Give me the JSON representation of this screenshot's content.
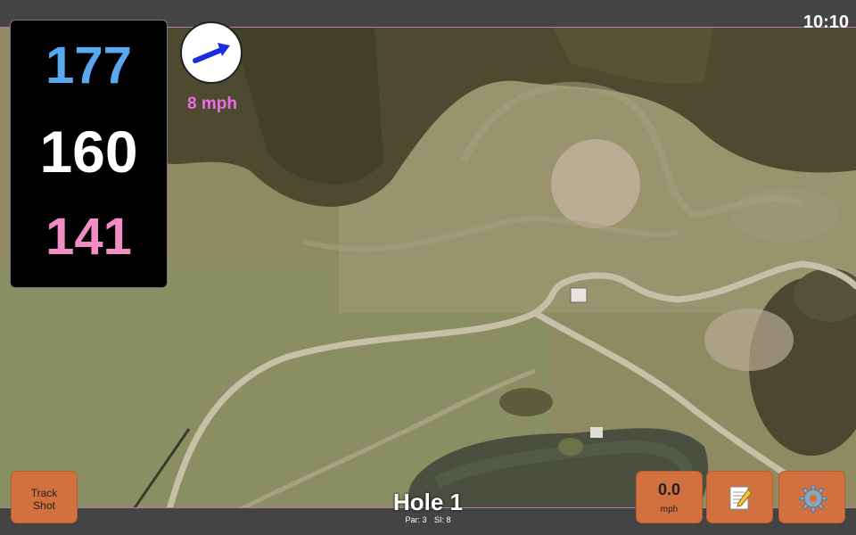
{
  "status_bar": {
    "time": "10:10"
  },
  "distances": {
    "back": "177",
    "middle": "160",
    "front": "141"
  },
  "wind": {
    "speed": "8 mph",
    "direction": "east-northeast",
    "arrow_color": "#1a2ee0",
    "icon": "wind-arrow-icon"
  },
  "buttons": {
    "track_shot_line1": "Track",
    "track_shot_line2": "Shot",
    "speed_value": "0.0",
    "speed_unit": "mph",
    "notes_icon": "notepad-icon",
    "settings_icon": "gear-icon"
  },
  "hole": {
    "title": "Hole 1",
    "par": "Par: 3",
    "si": "SI: 8"
  },
  "colors": {
    "back_distance": "#59a9ef",
    "middle_distance": "#ffffff",
    "front_distance": "#f28cc4",
    "wind_text": "#e96ee9",
    "button_bg": "#d2713f"
  }
}
